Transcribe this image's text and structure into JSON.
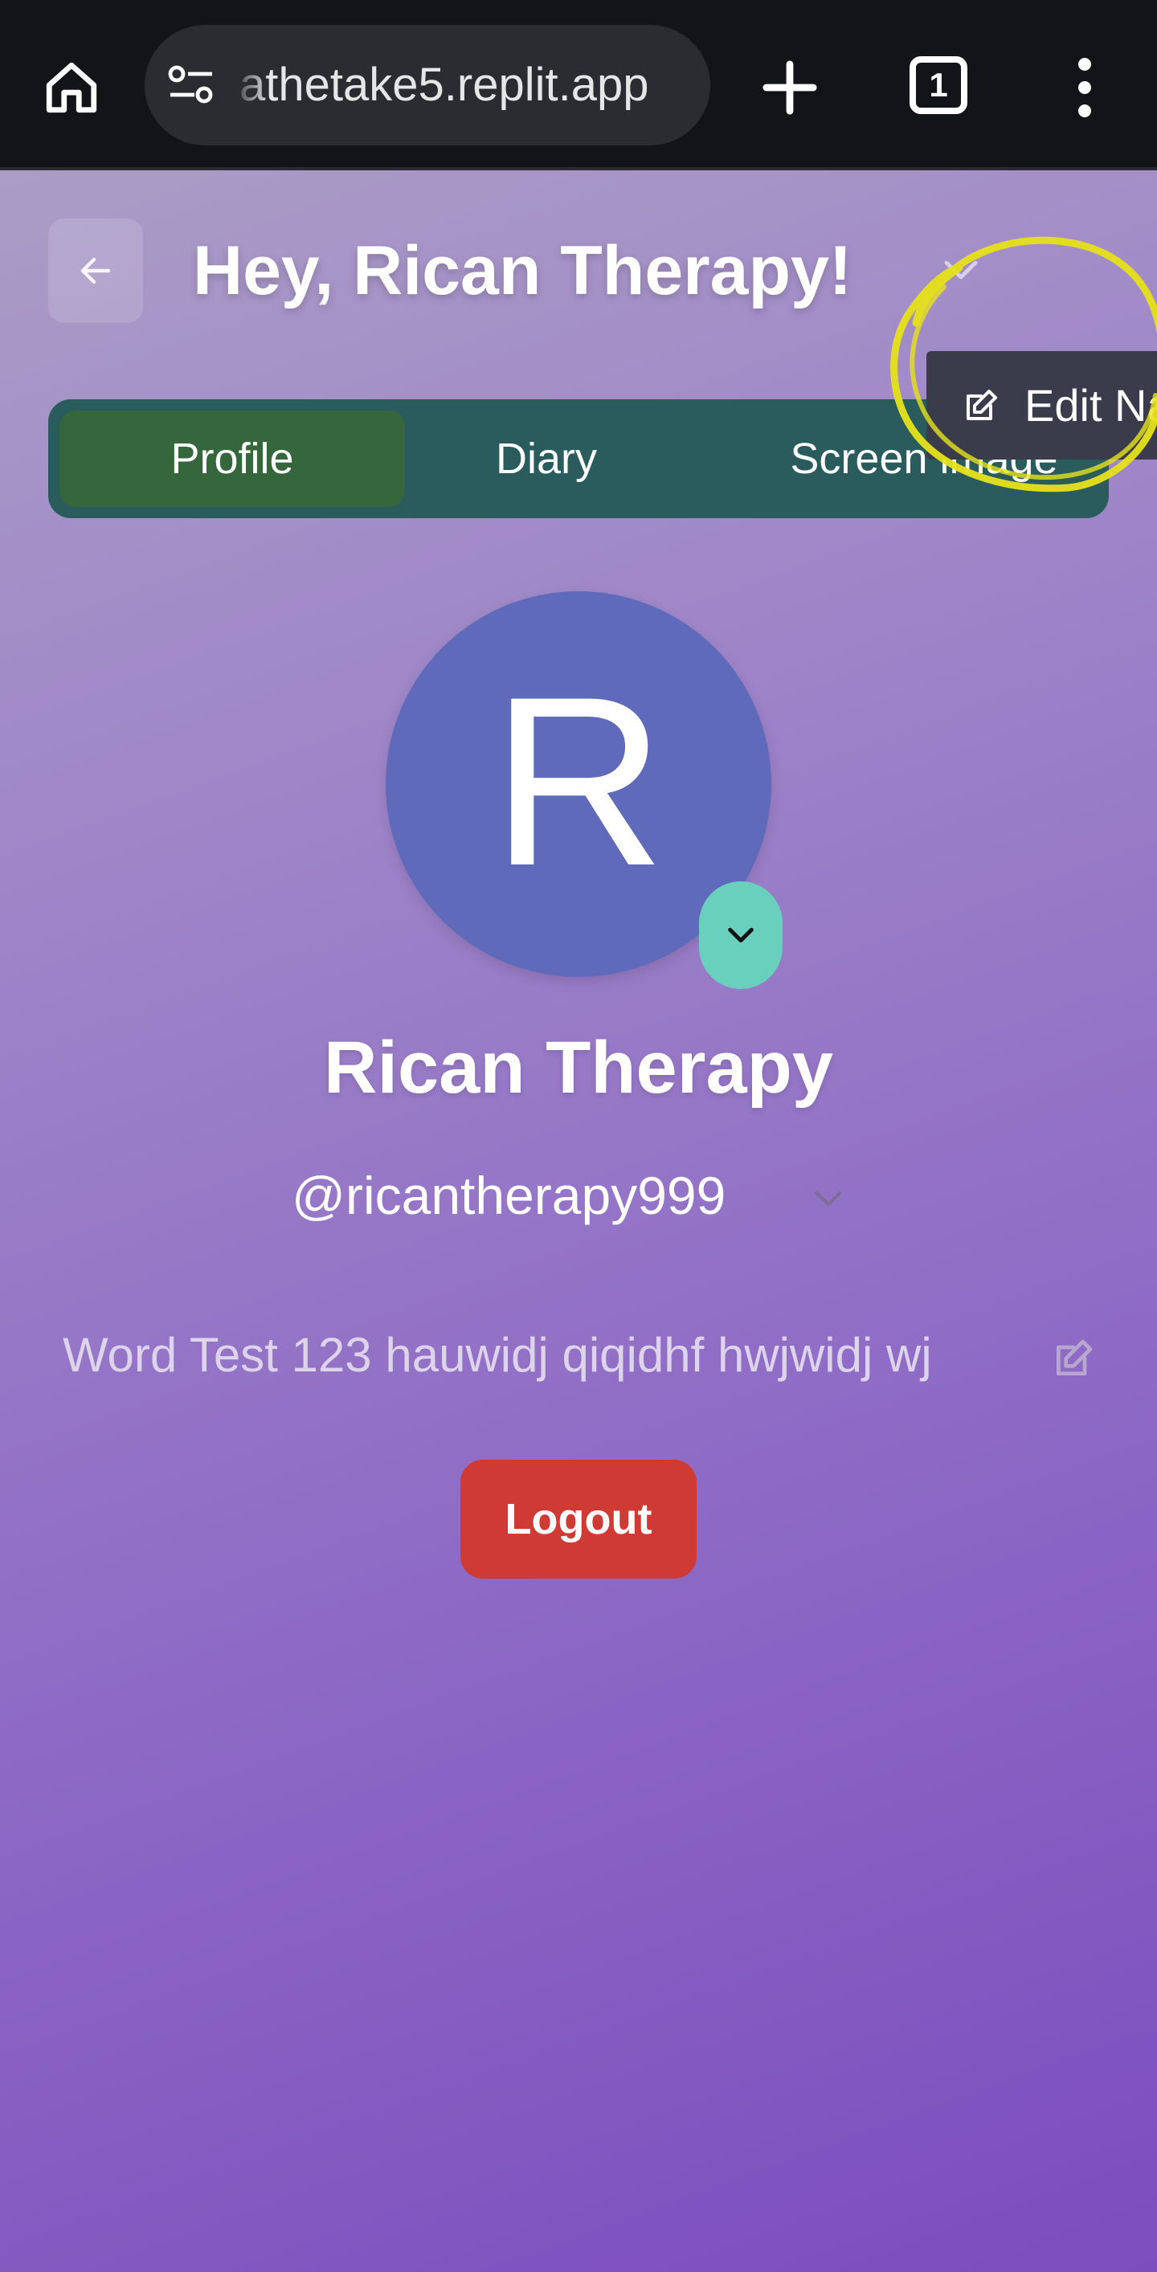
{
  "browser": {
    "url": "athetake5.replit.app",
    "tab_count": "1",
    "icons": [
      "home-icon",
      "site-info-icon",
      "plus-icon",
      "tab-switcher-icon",
      "more-vert-icon"
    ]
  },
  "header": {
    "greeting": "Hey, Rican Therapy!"
  },
  "tabs": [
    {
      "label": "Profile",
      "active": true
    },
    {
      "label": "Diary",
      "active": false
    },
    {
      "label": "Screen image",
      "active": false
    }
  ],
  "dropdown": {
    "edit_name_label": "Edit Na"
  },
  "profile": {
    "avatar_letter": "R",
    "display_name": "Rican Therapy",
    "handle": "@ricantherapy999",
    "bio": "Word Test 123 hauwidj qiqidhf hwjwidj wj"
  },
  "actions": {
    "logout_label": "Logout"
  },
  "colors": {
    "browser_bar": "#131418",
    "tab_bar": "#2a5c5e",
    "active_tab": "#35663c",
    "avatar": "#5f6bba",
    "avatar_toggle": "#69d0bd",
    "logout": "#cf3a34",
    "annotation_highlight": "#e6e21a"
  }
}
